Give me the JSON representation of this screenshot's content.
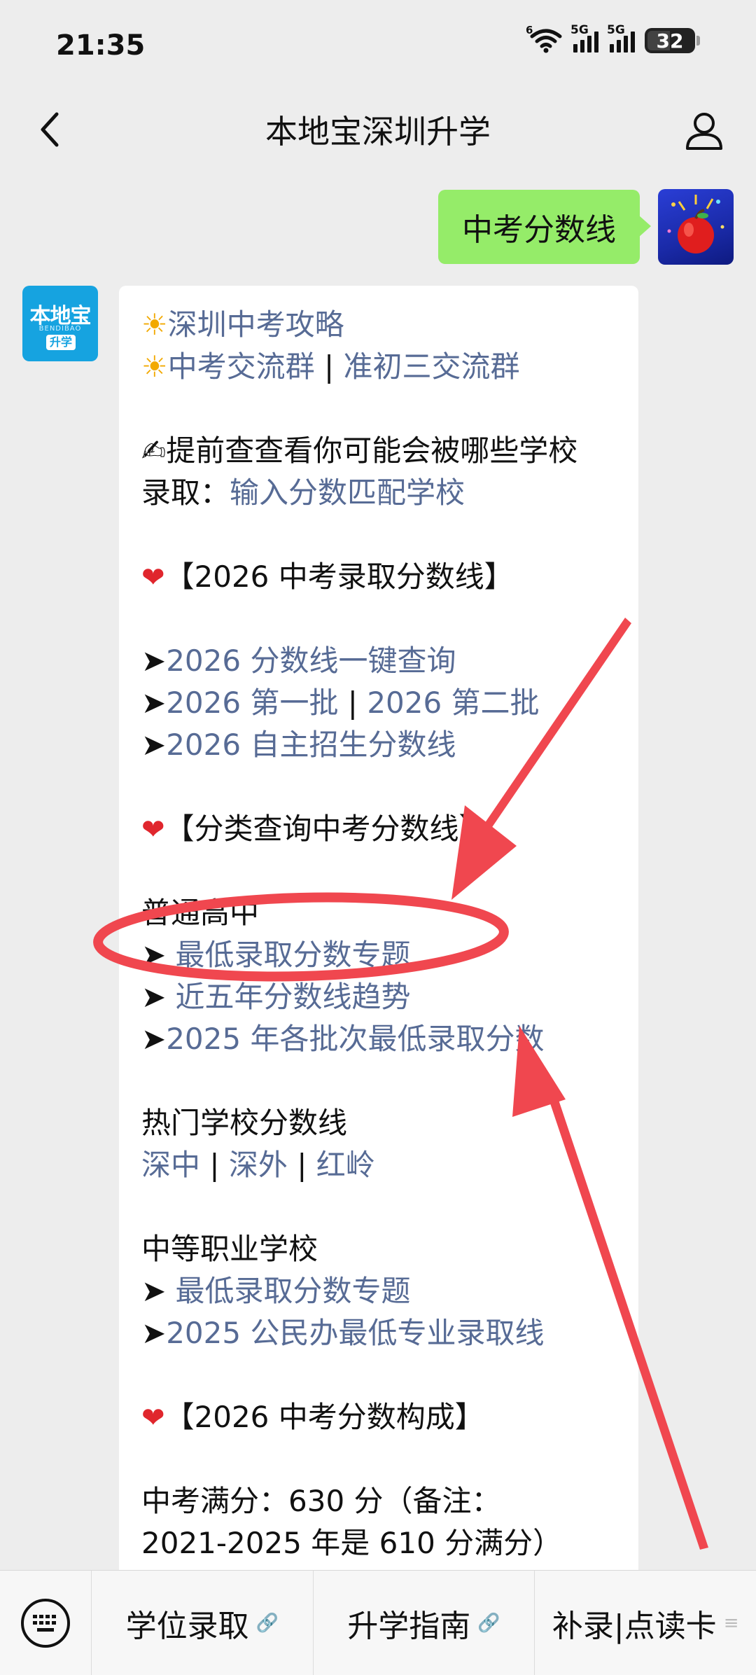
{
  "status_bar": {
    "time": "21:35",
    "network1": "5G",
    "network2": "5G",
    "wifi_label": "6",
    "battery": "32"
  },
  "header": {
    "title": "本地宝深圳升学"
  },
  "outgoing": {
    "text": "中考分数线"
  },
  "brand_avatar": {
    "top": "本地宝",
    "sub": "BENDIBAO",
    "pill": "升学"
  },
  "message": {
    "sun1": "深圳中考攻略",
    "sun2_a": "中考交流群",
    "sep": " | ",
    "sun2_b": "准初三交流群",
    "check_line1": "提前查查看你可能会被哪些学校",
    "check_line2_prefix": "录取：",
    "check_line2_link": "输入分数匹配学校",
    "section1": "【2026 中考录取分数线】",
    "link_a": "2026 分数线一键查询",
    "link_b1": "2026 第一批",
    "link_b2": "2026 第二批",
    "link_c": "2026 自主招生分数线",
    "section2": "【分类查询中考分数线】",
    "general_high": "普通高中",
    "gh_link1": "最低录取分数专题",
    "gh_link2": "近五年分数线趋势",
    "gh_link3": "2025 年各批次最低录取分数",
    "hot_schools": "热门学校分数线",
    "school1": "深中",
    "school2": "深外",
    "school3": "红岭",
    "vocational": "中等职业学校",
    "voc_link1": "最低录取分数专题",
    "voc_link2": "2025 公民办最低专业录取线",
    "section3": "【2026 中考分数构成】",
    "full_score_line1": "中考满分：630 分（备注：",
    "full_score_line2": "2021-2025 年是 610 分满分）"
  },
  "bottom_menu": {
    "item1": "学位录取",
    "item2": "升学指南",
    "item3": "补录|点读卡"
  },
  "colors": {
    "link": "#576b95",
    "bubble_out": "#95ec69",
    "annotation": "#f0474f"
  }
}
